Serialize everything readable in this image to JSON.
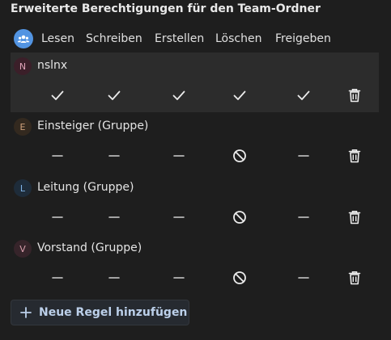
{
  "title": "Erweiterte Berechtigungen für den Team-Ordner",
  "header": {
    "icon": "group-icon",
    "columns": [
      "Lesen",
      "Schreiben",
      "Erstellen",
      "Löschen",
      "Freigeben"
    ]
  },
  "entries": [
    {
      "initial": "N",
      "name": "nslnx",
      "selected": true,
      "avatar_bg": "#3b1f29",
      "avatar_fg": "#e0a2b8",
      "permissions": [
        "allow",
        "allow",
        "allow",
        "allow",
        "allow"
      ]
    },
    {
      "initial": "E",
      "name": "Einsteiger (Gruppe)",
      "selected": false,
      "avatar_bg": "#33291f",
      "avatar_fg": "#cfa27c",
      "permissions": [
        "inherit",
        "inherit",
        "inherit",
        "deny",
        "inherit"
      ]
    },
    {
      "initial": "L",
      "name": "Leitung (Gruppe)",
      "selected": false,
      "avatar_bg": "#1e2c3a",
      "avatar_fg": "#7fb3e6",
      "permissions": [
        "inherit",
        "inherit",
        "inherit",
        "deny",
        "inherit"
      ]
    },
    {
      "initial": "V",
      "name": "Vorstand (Gruppe)",
      "selected": false,
      "avatar_bg": "#36242a",
      "avatar_fg": "#d9a0ae",
      "permissions": [
        "inherit",
        "inherit",
        "inherit",
        "deny",
        "inherit"
      ]
    }
  ],
  "delete_icon": "trash-icon",
  "add_button": {
    "label": "Neue Regel hinzufügen",
    "icon": "plus-icon"
  },
  "colors": {
    "background": "#1e1e1e",
    "selected_row": "#2c2c2c",
    "accent": "#5294e2"
  }
}
